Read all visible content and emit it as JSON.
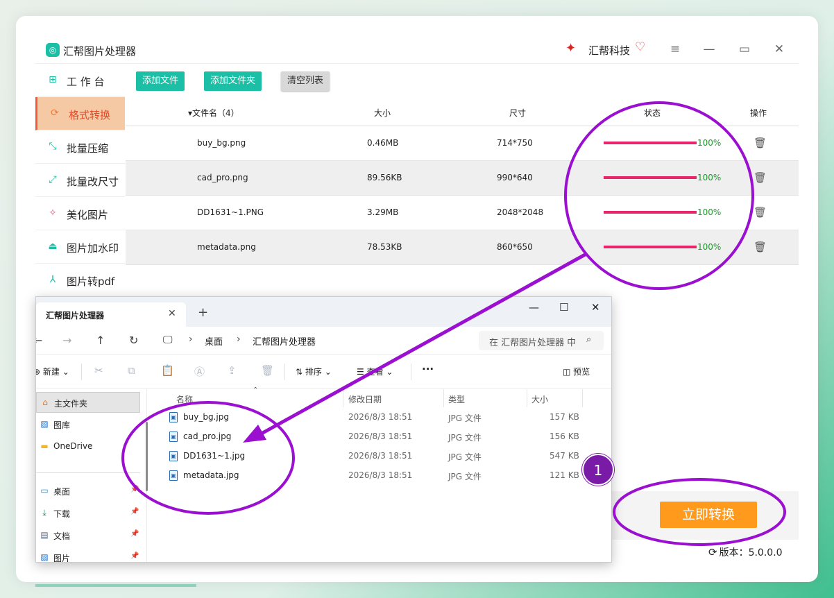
{
  "app": {
    "title": "汇帮图片处理器",
    "brand": "汇帮科技",
    "logo_icon": "app-logo-icon",
    "window_controls": [
      "menu-icon",
      "minimize-icon",
      "maximize-icon",
      "close-icon"
    ]
  },
  "sidebar": {
    "items": [
      {
        "label": "工 作 台",
        "icon": "grid-icon"
      },
      {
        "label": "格式转换",
        "icon": "convert-icon",
        "active": true
      },
      {
        "label": "批量压缩",
        "icon": "compress-icon"
      },
      {
        "label": "批量改尺寸",
        "icon": "resize-icon"
      },
      {
        "label": "美化图片",
        "icon": "beautify-icon"
      },
      {
        "label": "图片加水印",
        "icon": "watermark-icon"
      },
      {
        "label": "图片转pdf",
        "icon": "pdf-icon"
      }
    ]
  },
  "toolbar": {
    "add_file": "添加文件",
    "add_folder": "添加文件夹",
    "clear_list": "清空列表"
  },
  "table": {
    "headers": {
      "filename": "▾文件名（4）",
      "size": "大小",
      "dimensions": "尺寸",
      "status": "状态",
      "action": "操作"
    },
    "rows": [
      {
        "name": "buy_bg.png",
        "size": "0.46MB",
        "dim": "714*750",
        "progress": 1.0,
        "pct": "100%"
      },
      {
        "name": "cad_pro.png",
        "size": "89.56KB",
        "dim": "990*640",
        "progress": 1.0,
        "pct": "100%"
      },
      {
        "name": "DD1631~1.PNG",
        "size": "3.29MB",
        "dim": "2048*2048",
        "progress": 1.0,
        "pct": "100%"
      },
      {
        "name": "metadata.png",
        "size": "78.53KB",
        "dim": "860*650",
        "progress": 1.0,
        "pct": "100%"
      }
    ]
  },
  "convert_button": "立即转换",
  "version": "版本：5.0.0.0",
  "explorer": {
    "tab_title": "汇帮图片处理器",
    "breadcrumb": [
      "桌面",
      "汇帮图片处理器"
    ],
    "search_placeholder": "在 汇帮图片处理器 中搜索",
    "commands": {
      "new": "新建",
      "sort": "排序",
      "view": "查看",
      "more": "···",
      "preview": "预览"
    },
    "nav": [
      {
        "label": "主文件夹",
        "icon": "home-icon",
        "selected": true
      },
      {
        "label": "图库",
        "icon": "gallery-icon"
      },
      {
        "label": "OneDrive",
        "icon": "folder-icon"
      },
      {
        "label": "桌面",
        "icon": "desktop-icon",
        "pinned": true
      },
      {
        "label": "下载",
        "icon": "download-icon",
        "pinned": true
      },
      {
        "label": "文档",
        "icon": "document-icon",
        "pinned": true
      },
      {
        "label": "图片",
        "icon": "pictures-icon",
        "pinned": true
      }
    ],
    "columns": {
      "name": "名称",
      "modified": "修改日期",
      "type": "类型",
      "size": "大小"
    },
    "files": [
      {
        "name": "buy_bg.jpg",
        "modified": "2026/8/3 18:51",
        "type": "JPG 文件",
        "size": "157 KB"
      },
      {
        "name": "cad_pro.jpg",
        "modified": "2026/8/3 18:51",
        "type": "JPG 文件",
        "size": "156 KB"
      },
      {
        "name": "DD1631~1.jpg",
        "modified": "2026/8/3 18:51",
        "type": "JPG 文件",
        "size": "547 KB"
      },
      {
        "name": "metadata.jpg",
        "modified": "2026/8/3 18:51",
        "type": "JPG 文件",
        "size": "121 KB"
      }
    ]
  },
  "annotations": {
    "step_number": "1",
    "highlight_color": "#9a0fd0"
  }
}
